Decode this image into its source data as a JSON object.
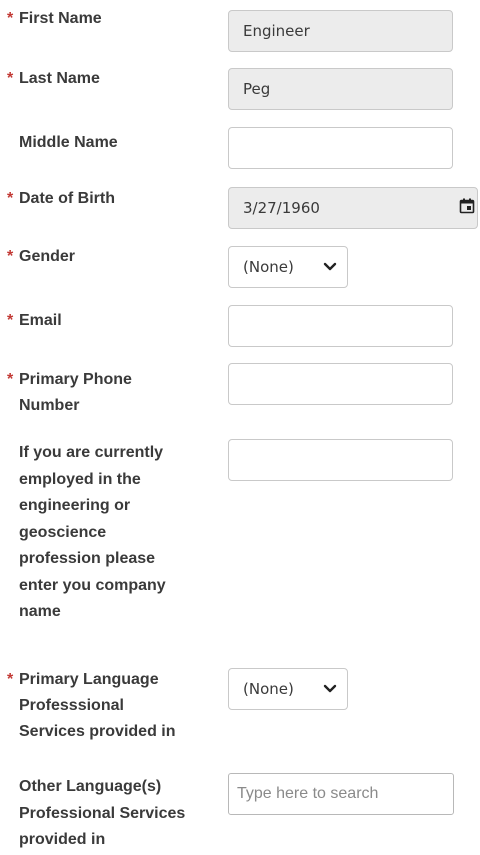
{
  "required_marker": "*",
  "fields": {
    "first_name": {
      "label": "First Name",
      "value": "Engineer"
    },
    "last_name": {
      "label": "Last Name",
      "value": "Peg"
    },
    "middle_name": {
      "label": "Middle Name",
      "value": ""
    },
    "dob": {
      "label": "Date of Birth",
      "value": "3/27/1960"
    },
    "gender": {
      "label": "Gender",
      "value": "(None)"
    },
    "email": {
      "label": "Email",
      "value": ""
    },
    "phone": {
      "label_line1": "Primary Phone",
      "label_line2": "Number",
      "value": ""
    },
    "company": {
      "label_lines": [
        "If you are currently",
        "employed in the",
        "engineering or",
        "geoscience",
        "profession please",
        "enter you company",
        "name"
      ],
      "value": ""
    },
    "primary_language": {
      "label_line1": "Primary Language",
      "label_line2": "Professsional",
      "label_line3": "Services provided in",
      "value": "(None)"
    },
    "other_languages": {
      "label_line1": "Other Language(s)",
      "label_line2": "Professional Services",
      "label_line3": "provided in",
      "placeholder": "Type here to search"
    }
  },
  "icons": {
    "calendar": "calendar-icon",
    "chevron": "chevron-down-icon"
  },
  "colors": {
    "required": "#c23934",
    "label": "#3a3a3a",
    "readonly_bg": "#ececec",
    "border": "#c9c9c9"
  }
}
